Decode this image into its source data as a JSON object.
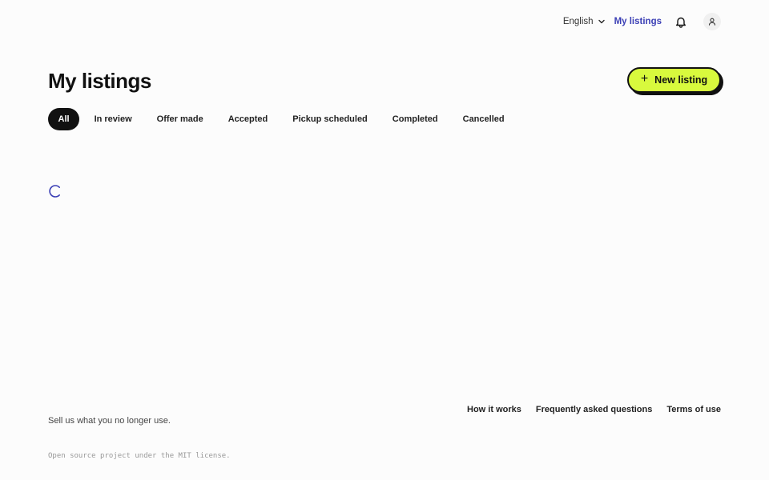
{
  "topnav": {
    "language": "English",
    "my_listings": "My listings"
  },
  "header": {
    "title": "My listings",
    "new_listing_label": "New listing"
  },
  "tabs": [
    {
      "label": "All",
      "active": true
    },
    {
      "label": "In review",
      "active": false
    },
    {
      "label": "Offer made",
      "active": false
    },
    {
      "label": "Accepted",
      "active": false
    },
    {
      "label": "Pickup scheduled",
      "active": false
    },
    {
      "label": "Completed",
      "active": false
    },
    {
      "label": "Cancelled",
      "active": false
    }
  ],
  "footer": {
    "links": [
      "How it works",
      "Frequently asked questions",
      "Terms of use"
    ],
    "tagline": "Sell us what you no longer use.",
    "license": "Open source project under the MIT license."
  },
  "colors": {
    "accent_button": "#d8f93d",
    "link": "#3b3fb5",
    "spinner": "#3b3fb5"
  },
  "icons": {
    "language_dropdown": "chevron-down-icon",
    "notifications": "bell-icon",
    "account": "user-icon",
    "new_listing": "plus-icon",
    "loading": "spinner-icon"
  }
}
